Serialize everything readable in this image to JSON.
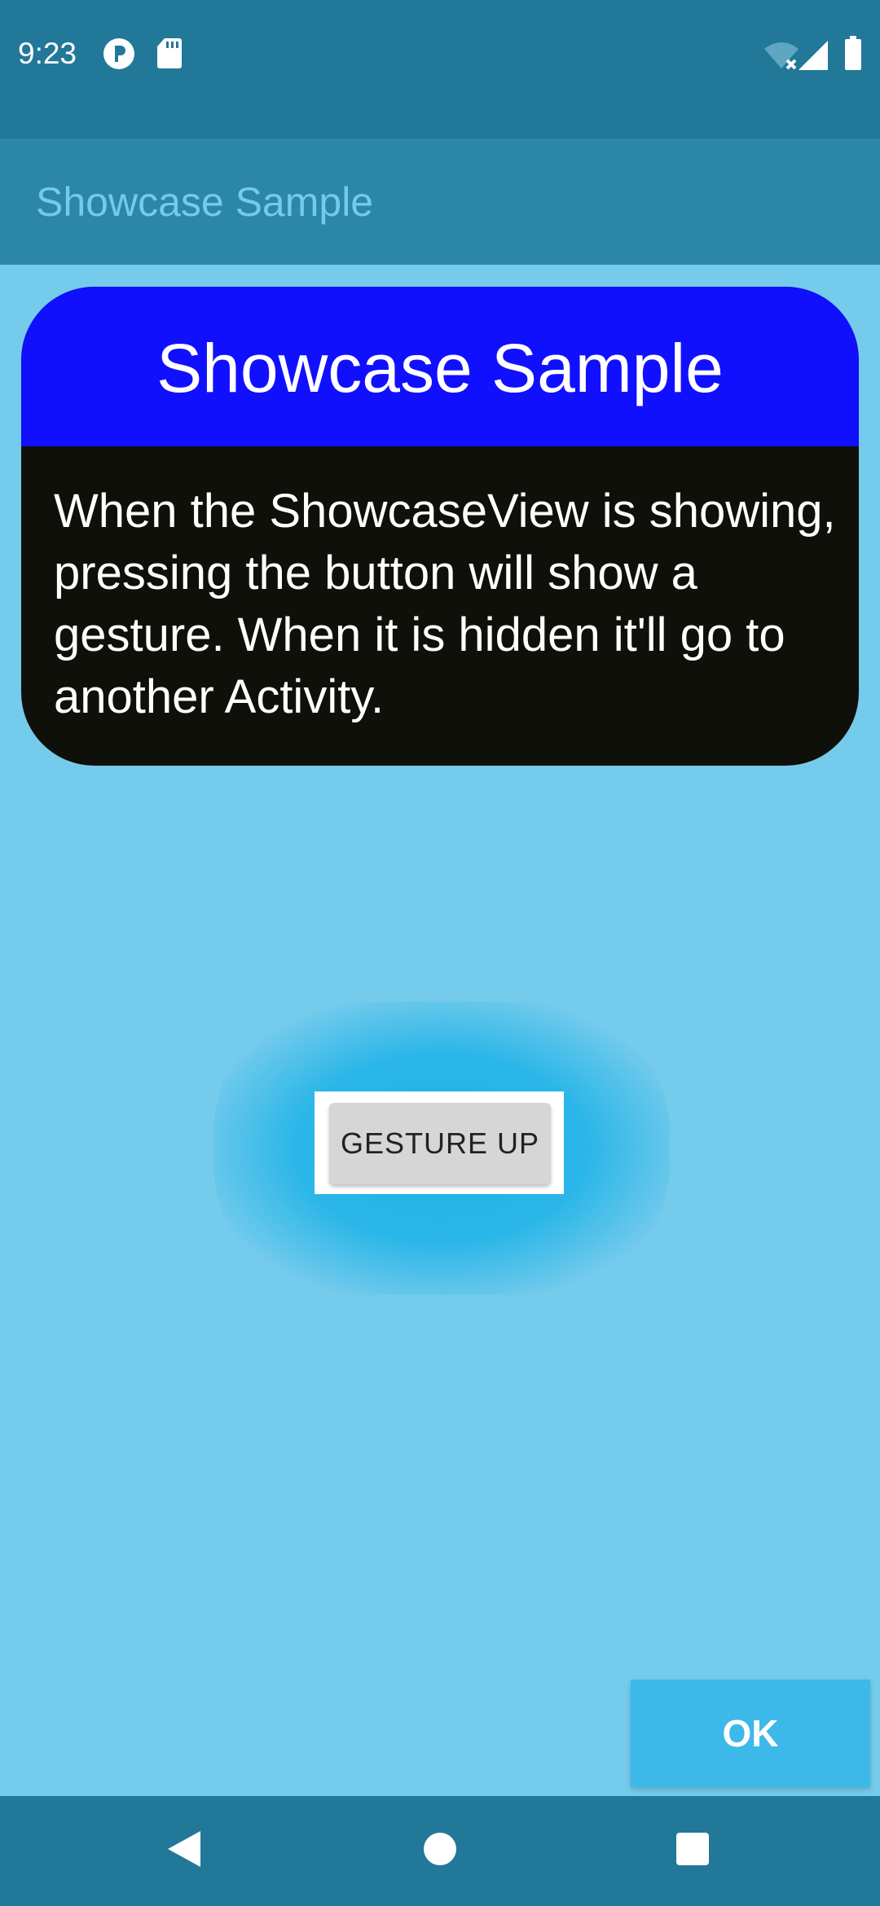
{
  "status_bar": {
    "time": "9:23",
    "icons": [
      "notification-p-icon",
      "sd-card-icon",
      "wifi-off-icon",
      "signal-icon",
      "battery-icon"
    ]
  },
  "app_bar": {
    "title": "Showcase Sample"
  },
  "showcase": {
    "title": "Showcase Sample",
    "description": "When the ShowcaseView is showing, pressing the button will show a gesture. When it is hidden it'll go to another Activity.",
    "header_color": "#1010ff",
    "body_color": "#10100a"
  },
  "main": {
    "gesture_button_label": "GESTURE UP"
  },
  "ok_button": {
    "label": "OK",
    "color": "#3cb9e8"
  },
  "nav_bar": {
    "buttons": [
      "back-icon",
      "home-icon",
      "recents-icon"
    ]
  },
  "colors": {
    "status_bar": "#217899",
    "app_bar": "#2b86a8",
    "overlay_background": "#75cbec",
    "app_title": "#73c9ee"
  }
}
